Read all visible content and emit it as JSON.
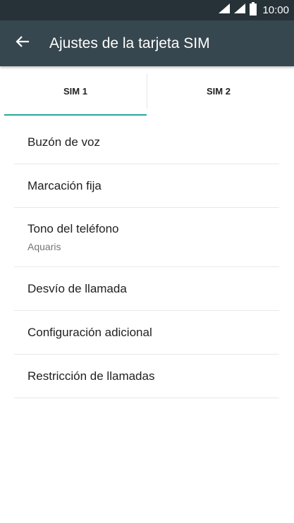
{
  "status_bar": {
    "time": "10:00",
    "icons": [
      "signal-icon",
      "signal-icon",
      "battery-icon"
    ]
  },
  "app_bar": {
    "back_icon": "arrow-back-icon",
    "title": "Ajustes de la tarjeta SIM"
  },
  "tabs": [
    {
      "label": "SIM 1",
      "selected": true
    },
    {
      "label": "SIM 2",
      "selected": false
    }
  ],
  "colors": {
    "status_bar": "#263238",
    "app_bar": "#37474f",
    "accent": "#26a69a"
  },
  "settings": [
    {
      "title": "Buzón de voz"
    },
    {
      "title": "Marcación fija"
    },
    {
      "title": "Tono del teléfono",
      "subtitle": "Aquaris"
    },
    {
      "title": "Desvío de llamada"
    },
    {
      "title": "Configuración adicional"
    },
    {
      "title": "Restricción de llamadas"
    }
  ]
}
